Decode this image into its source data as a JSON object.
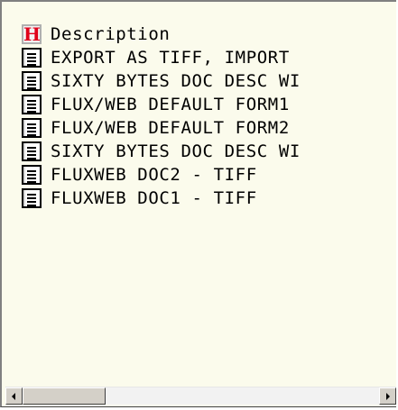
{
  "list": {
    "header": {
      "icon": "h-icon",
      "letter": "H",
      "label": "Description"
    },
    "items": [
      {
        "icon": "document-icon",
        "label": "EXPORT AS TIFF, IMPORT"
      },
      {
        "icon": "document-icon",
        "label": "SIXTY BYTES DOC DESC WI"
      },
      {
        "icon": "document-icon",
        "label": "FLUX/WEB DEFAULT FORM1"
      },
      {
        "icon": "document-icon",
        "label": "FLUX/WEB DEFAULT FORM2"
      },
      {
        "icon": "document-icon",
        "label": "SIXTY BYTES DOC DESC WI"
      },
      {
        "icon": "document-icon",
        "label": "FLUXWEB DOC2 - TIFF"
      },
      {
        "icon": "document-icon",
        "label": "FLUXWEB DOC1 - TIFF"
      }
    ]
  },
  "scrollbar": {
    "orientation": "horizontal",
    "position": 0.0
  },
  "colors": {
    "panel_bg": "#fbfbec",
    "header_icon_letter": "#e0001a"
  }
}
